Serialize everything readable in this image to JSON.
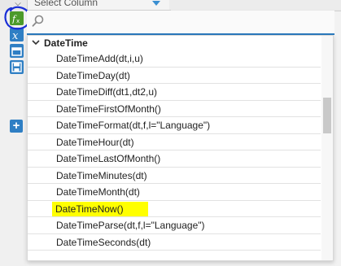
{
  "top_bar": {
    "select_column_label": "Select Column"
  },
  "toolbar": {
    "buttons": [
      {
        "name": "function-icon",
        "color": "#4c9a2a"
      },
      {
        "name": "variable-x-icon",
        "color": "#2f7fc4"
      },
      {
        "name": "window-icon",
        "color": "#2f7fc4"
      },
      {
        "name": "save-icon",
        "color": "#2f7fc4"
      }
    ],
    "add_label": "+"
  },
  "search": {
    "value": "",
    "placeholder": ""
  },
  "function_group": {
    "label": "DateTime",
    "items": [
      "DateTimeAdd(dt,i,u)",
      "DateTimeDay(dt)",
      "DateTimeDiff(dt1,dt2,u)",
      "DateTimeFirstOfMonth()",
      "DateTimeFormat(dt,f,l=\"Language\")",
      "DateTimeHour(dt)",
      "DateTimeLastOfMonth()",
      "DateTimeMinutes(dt)",
      "DateTimeMonth(dt)",
      "DateTimeNow()",
      "DateTimeParse(dt,f,l=\"Language\")",
      "DateTimeSeconds(dt)"
    ],
    "highlighted_item": "DateTimeNow()"
  },
  "colors": {
    "accent_blue": "#2b7bbf",
    "highlight": "#ffff00",
    "annotation": "#1a2fd6"
  }
}
